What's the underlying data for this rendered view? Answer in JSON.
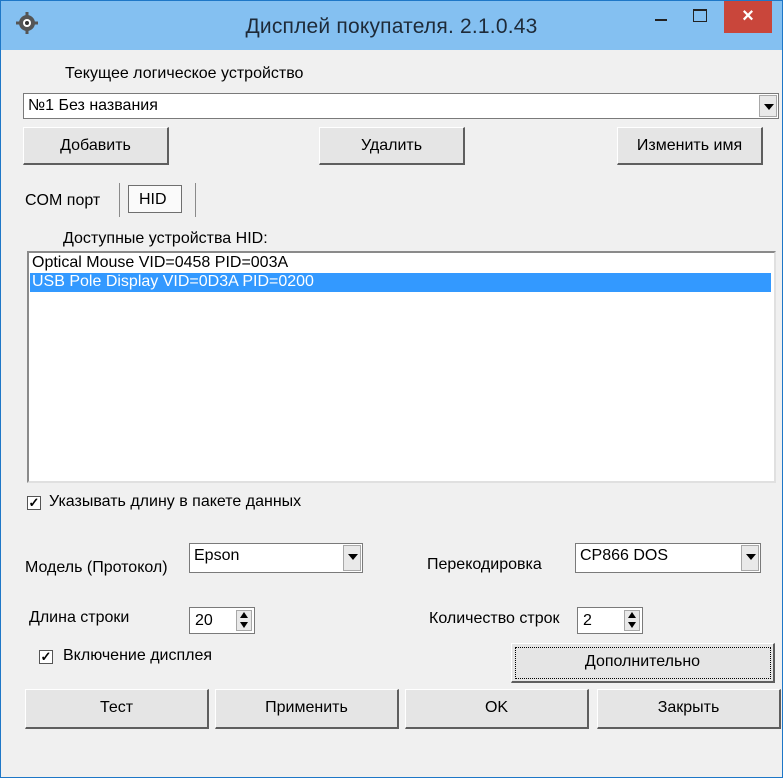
{
  "window": {
    "title": "Дисплей покупателя. 2.1.0.43",
    "close_glyph": "×"
  },
  "device": {
    "label": "Текущее логическое устройство",
    "value": "№1 Без названия",
    "add_label": "Добавить",
    "delete_label": "Удалить",
    "rename_label": "Изменить имя"
  },
  "tabs": [
    {
      "label": "COM порт"
    },
    {
      "label": "HID"
    }
  ],
  "hid": {
    "list_label": "Доступные устройства HID:",
    "devices": [
      {
        "label": "Optical Mouse VID=0458 PID=003A"
      },
      {
        "label": "USB Pole Display VID=0D3A PID=0200"
      }
    ],
    "selected_index": 1
  },
  "options": {
    "length_in_packet": {
      "label": "Указывать длину в пакете данных",
      "checked": true,
      "mark": "✓"
    },
    "model_label": "Модель (Протокол)",
    "model_value": "Epson",
    "encoding_label": "Перекодировка",
    "encoding_value": "CP866 DOS",
    "line_length_label": "Длина строки",
    "line_length_value": "20",
    "line_count_label": "Количество строк",
    "line_count_value": "2",
    "display_on": {
      "label": "Включение дисплея",
      "checked": true,
      "mark": "✓"
    },
    "advanced_label": "Дополнительно"
  },
  "footer": {
    "test_label": "Тест",
    "apply_label": "Применить",
    "ok_label": "OK",
    "close_label": "Закрыть"
  }
}
